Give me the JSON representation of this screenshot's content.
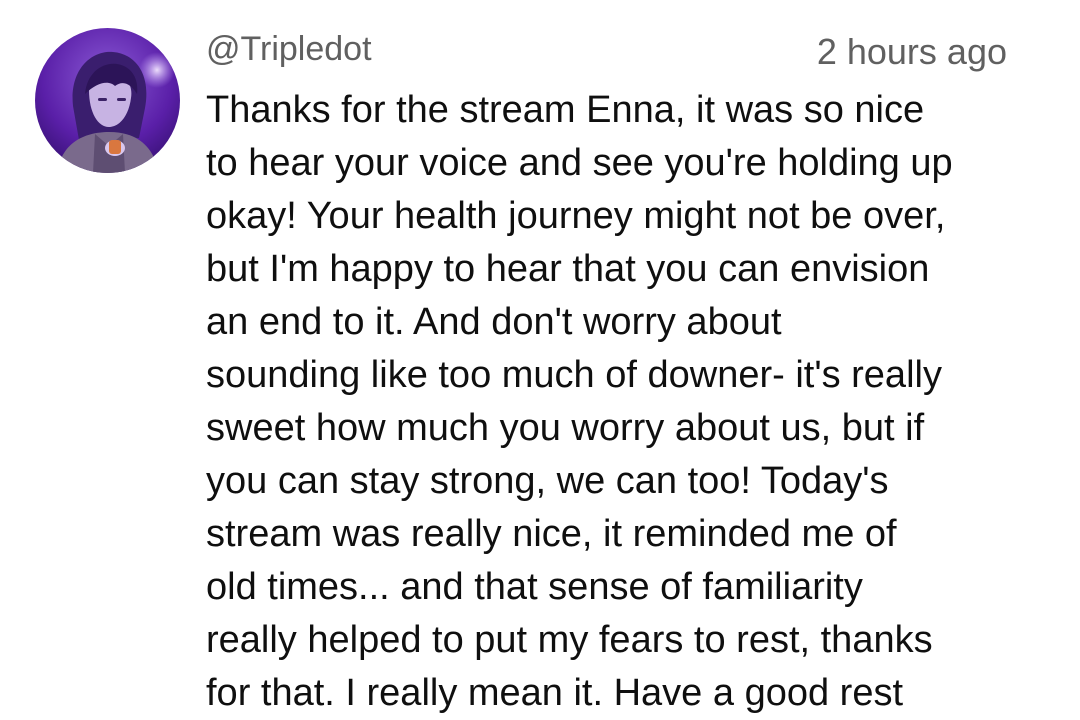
{
  "comment": {
    "author_handle": "@Tripledot",
    "timestamp": "2 hours ago",
    "avatar_icon": "user-avatar-anime-character",
    "body_lines": [
      "Thanks for the stream Enna, it was so nice",
      "to hear your voice and see you're holding up",
      "okay! Your health journey might not be over,",
      "but I'm happy to hear that you can envision",
      "an end to it. And don't worry about",
      "sounding like too much of downer- it's really",
      "sweet how much you worry about us, but if",
      "you can stay strong, we can too! Today's",
      "stream was really nice, it reminded me of",
      "old times... and that sense of familiarity",
      "really helped to put my fears to rest, thanks",
      "for that. I really mean it. Have a good rest"
    ]
  },
  "colors": {
    "background": "#ffffff",
    "text_primary": "#0f0f0f",
    "text_secondary": "#606060",
    "avatar_accent": "#6a2fb5"
  }
}
